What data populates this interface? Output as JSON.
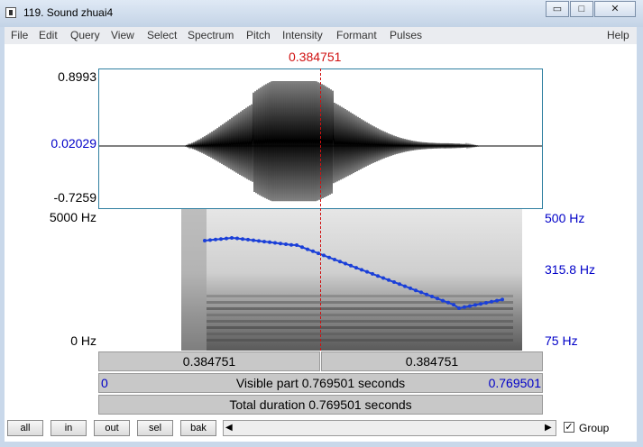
{
  "window": {
    "title": "119. Sound zhuai4",
    "minimize_label": "▭",
    "maximize_label": "□",
    "close_label": "✕"
  },
  "menu": [
    "File",
    "Edit",
    "Query",
    "View",
    "Select",
    "Spectrum",
    "Pitch",
    "Intensity",
    "Formant",
    "Pulses",
    "Help"
  ],
  "cursor_time": "0.384751",
  "waveform": {
    "max": "0.8993",
    "mid": "0.02029",
    "min": "-0.7259"
  },
  "spectrogram": {
    "top_freq": "5000 Hz",
    "bottom_freq": "0 Hz"
  },
  "pitch_axis": {
    "top": "500 Hz",
    "mid": "315.8 Hz",
    "bottom": "75 Hz"
  },
  "time_bars": {
    "left_segment": "0.384751",
    "right_segment": "0.384751",
    "start": "0",
    "visible": "Visible part 0.769501 seconds",
    "end": "0.769501",
    "total": "Total duration 0.769501 seconds"
  },
  "buttons": {
    "all": "all",
    "in": "in",
    "out": "out",
    "sel": "sel",
    "bak": "bak"
  },
  "group_label": "Group",
  "group_checked": true,
  "colors": {
    "cursor": "#d01010",
    "axis_blue": "#0000c8",
    "pitch": "#1a3fd8"
  }
}
